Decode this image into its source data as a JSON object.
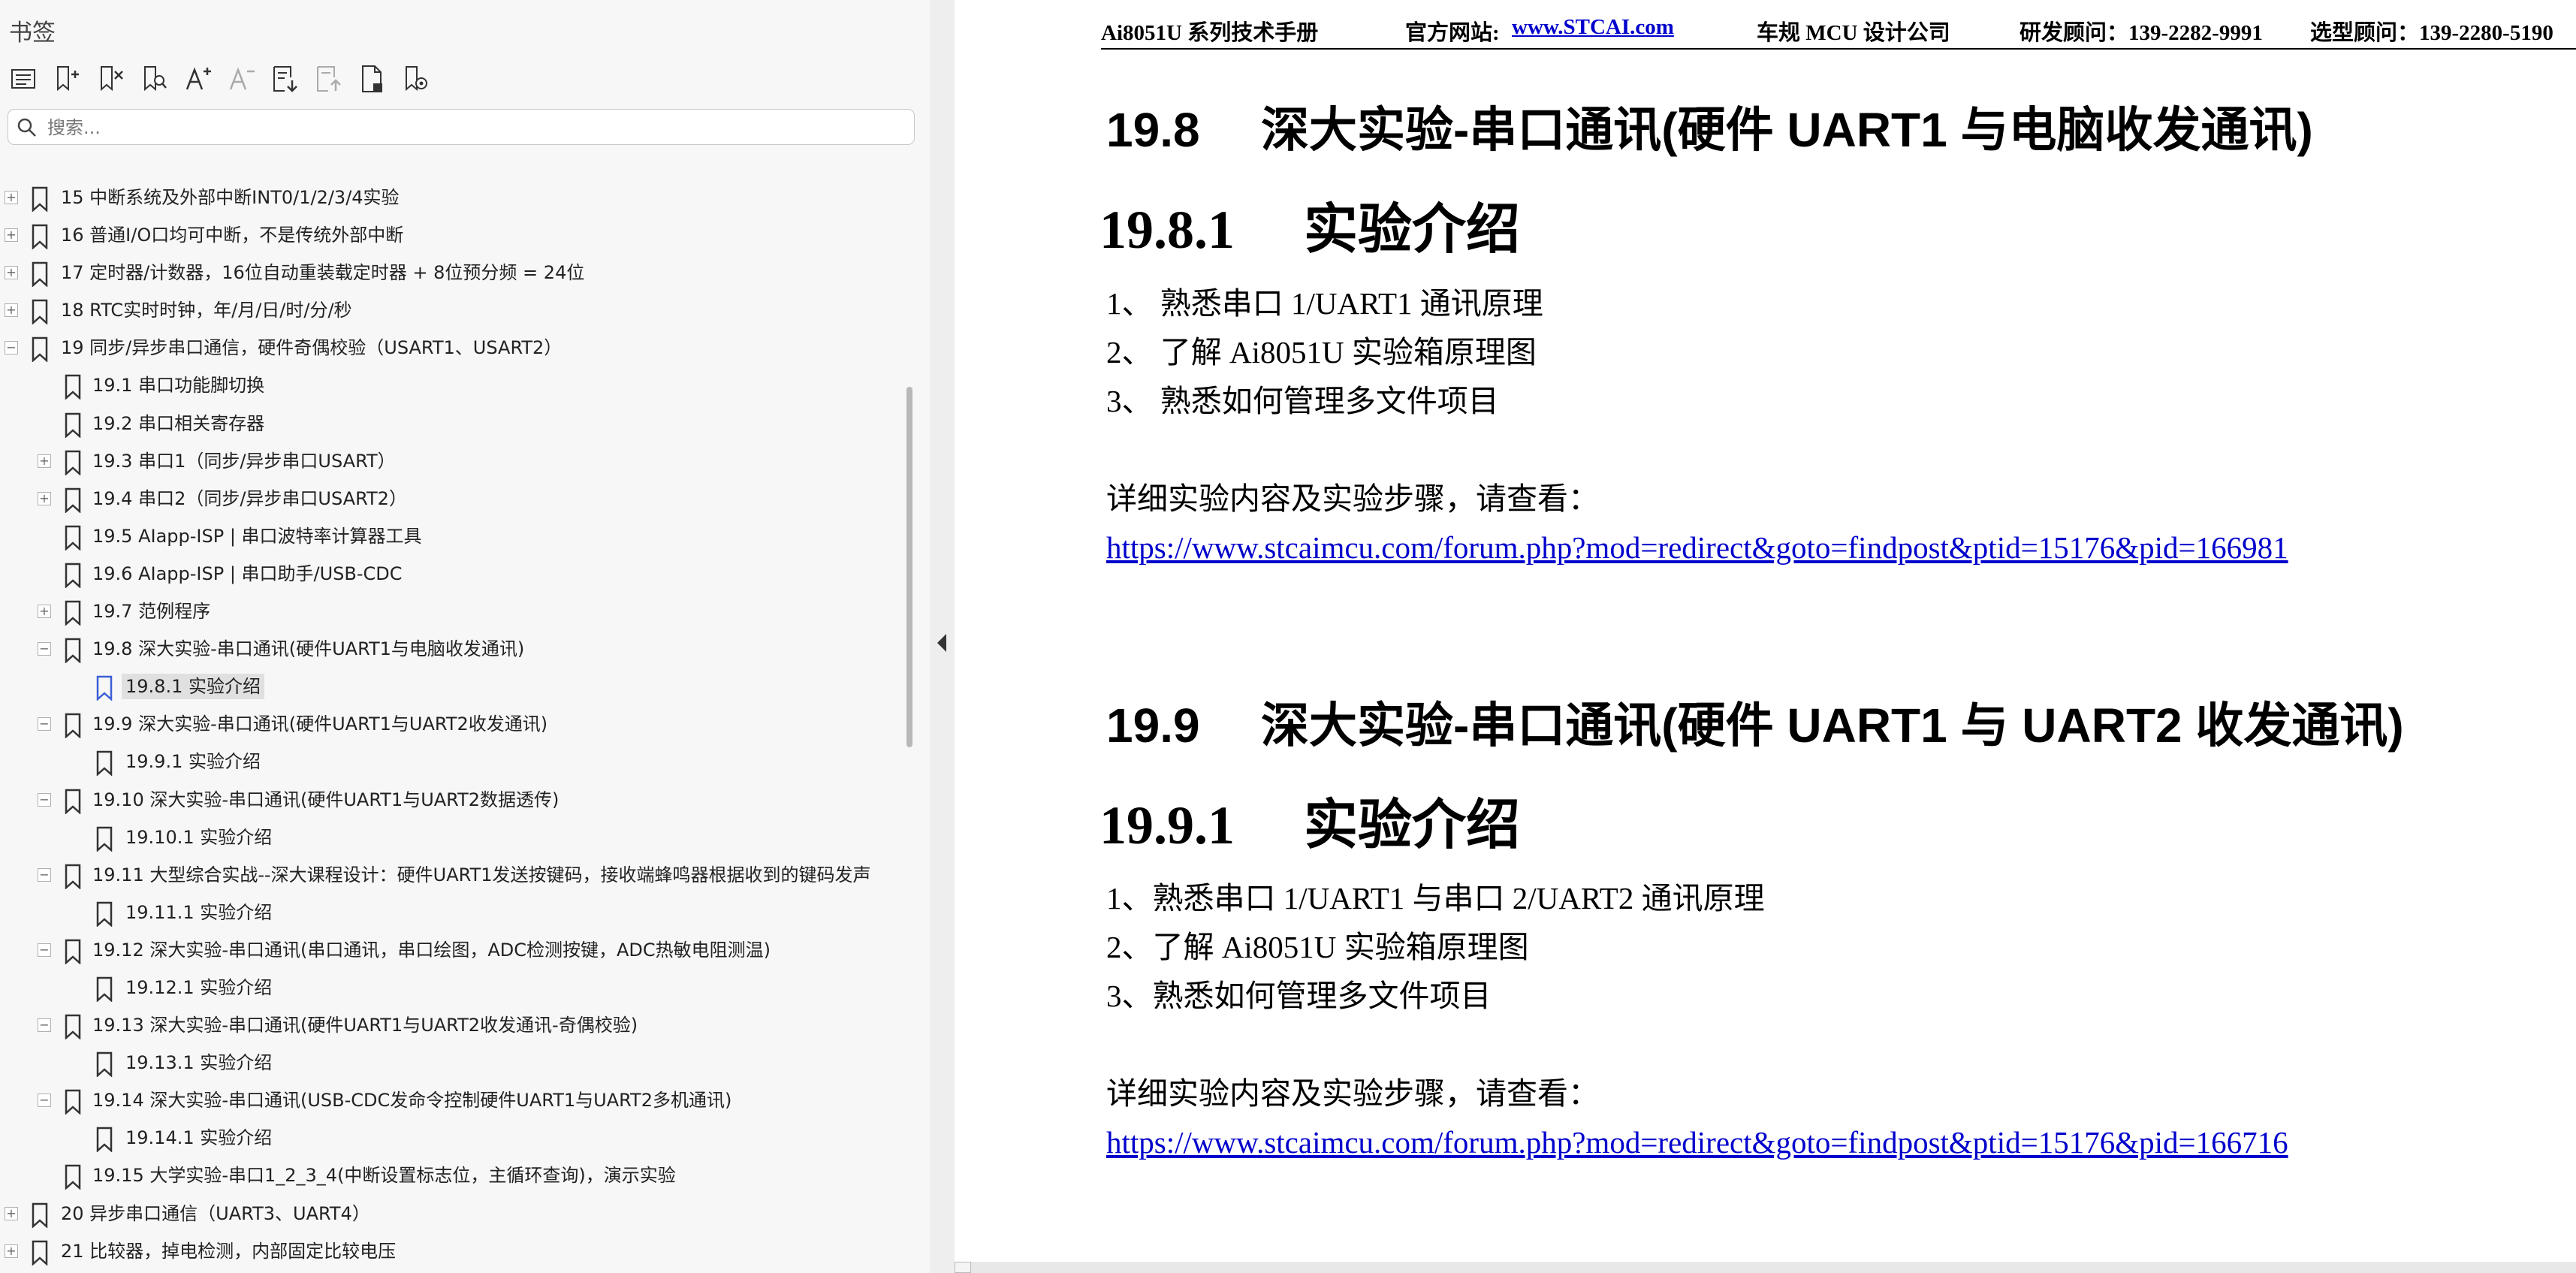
{
  "panel": {
    "title": "书签"
  },
  "search": {
    "placeholder": "搜索..."
  },
  "tree": [
    {
      "label": "15  中断系统及外部中断INT0/1/2/3/4实验",
      "level": 0,
      "exp": "+"
    },
    {
      "label": "16  普通I/O口均可中断，不是传统外部中断",
      "level": 0,
      "exp": "+"
    },
    {
      "label": "17  定时器/计数器，16位自动重装载定时器 + 8位预分频 = 24位",
      "level": 0,
      "exp": "+"
    },
    {
      "label": "18  RTC实时时钟，年/月/日/时/分/秒",
      "level": 0,
      "exp": "+"
    },
    {
      "label": "19  同步/异步串口通信，硬件奇偶校验（USART1、USART2）",
      "level": 0,
      "exp": "-"
    },
    {
      "label": "19.1  串口功能脚切换",
      "level": 1,
      "exp": ""
    },
    {
      "label": "19.2  串口相关寄存器",
      "level": 1,
      "exp": ""
    },
    {
      "label": "19.3  串口1（同步/异步串口USART）",
      "level": 1,
      "exp": "+"
    },
    {
      "label": "19.4  串口2（同步/异步串口USART2）",
      "level": 1,
      "exp": "+"
    },
    {
      "label": "19.5  AIapp-ISP | 串口波特率计算器工具",
      "level": 1,
      "exp": ""
    },
    {
      "label": "19.6  AIapp-ISP | 串口助手/USB-CDC",
      "level": 1,
      "exp": ""
    },
    {
      "label": "19.7  范例程序",
      "level": 1,
      "exp": "+"
    },
    {
      "label": "19.8  深大实验-串口通讯(硬件UART1与电脑收发通讯)",
      "level": 1,
      "exp": "-"
    },
    {
      "label": "19.8.1 实验介绍",
      "level": 2,
      "exp": "",
      "selected": true
    },
    {
      "label": "19.9 深大实验-串口通讯(硬件UART1与UART2收发通讯)",
      "level": 1,
      "exp": "-"
    },
    {
      "label": "19.9.1 实验介绍",
      "level": 2,
      "exp": ""
    },
    {
      "label": "19.10 深大实验-串口通讯(硬件UART1与UART2数据透传)",
      "level": 1,
      "exp": "-"
    },
    {
      "label": "19.10.1 实验介绍",
      "level": 2,
      "exp": ""
    },
    {
      "label": "19.11  大型综合实战--深大课程设计：硬件UART1发送按键码，接收端蜂鸣器根据收到的键码发声",
      "level": 1,
      "exp": "-"
    },
    {
      "label": "19.11.1 实验介绍",
      "level": 2,
      "exp": ""
    },
    {
      "label": "19.12 深大实验-串口通讯(串口通讯，串口绘图，ADC检测按键，ADC热敏电阻测温)",
      "level": 1,
      "exp": "-"
    },
    {
      "label": "19.12.1 实验介绍",
      "level": 2,
      "exp": ""
    },
    {
      "label": "19.13  深大实验-串口通讯(硬件UART1与UART2收发通讯-奇偶校验)",
      "level": 1,
      "exp": "-"
    },
    {
      "label": "19.13.1 实验介绍",
      "level": 2,
      "exp": ""
    },
    {
      "label": "19.14 深大实验-串口通讯(USB-CDC发命令控制硬件UART1与UART2多机通讯)",
      "level": 1,
      "exp": "-"
    },
    {
      "label": "19.14.1 实验介绍",
      "level": 2,
      "exp": ""
    },
    {
      "label": "19.15 大学实验-串口1_2_3_4(中断设置标志位，主循环查询)，演示实验",
      "level": 1,
      "exp": ""
    },
    {
      "label": "20  异步串口通信（UART3、UART4）",
      "level": 0,
      "exp": "+"
    },
    {
      "label": "21  比较器，掉电检测，内部固定比较电压",
      "level": 0,
      "exp": "+"
    }
  ],
  "header": {
    "manual": "Ai8051U 系列技术手册",
    "site_label": "官方网站:",
    "site_link": "www.STCAI.com",
    "company": "车规 MCU 设计公司",
    "advisor": "研发顾问：139-2282-9991",
    "selector": "选型顾问：139-2280-5190"
  },
  "doc": {
    "s198": {
      "num": "19.8",
      "title": "深大实验-串口通讯(硬件 UART1 与电脑收发通讯)"
    },
    "s1981": {
      "num": "19.8.1",
      "title": "实验介绍"
    },
    "s1981_items": [
      "1、 熟悉串口 1/UART1 通讯原理",
      "2、 了解 Ai8051U 实验箱原理图",
      "3、 熟悉如何管理多文件项目"
    ],
    "s1981_detail": "详细实验内容及实验步骤，请查看：",
    "s1981_url": "https://www.stcaimcu.com/forum.php?mod=redirect&goto=findpost&ptid=15176&pid=166981",
    "s199": {
      "num": "19.9",
      "title": "深大实验-串口通讯(硬件 UART1 与 UART2 收发通讯)"
    },
    "s1991": {
      "num": "19.9.1",
      "title": "实验介绍"
    },
    "s1991_items": [
      "1、熟悉串口 1/UART1 与串口 2/UART2 通讯原理",
      "2、了解 Ai8051U 实验箱原理图",
      "3、熟悉如何管理多文件项目"
    ],
    "s1991_detail": "详细实验内容及实验步骤，请查看：",
    "s1991_url": "https://www.stcaimcu.com/forum.php?mod=redirect&goto=findpost&ptid=15176&pid=166716"
  }
}
